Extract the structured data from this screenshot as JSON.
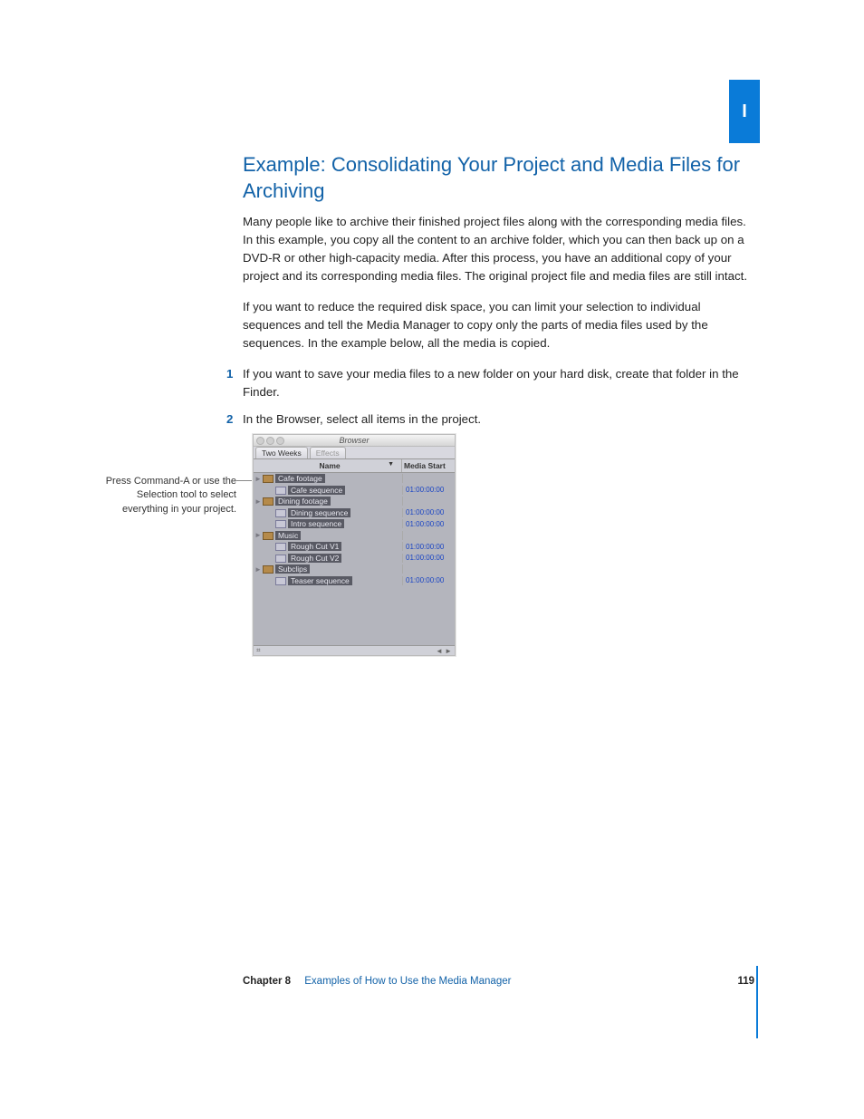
{
  "sidebar": {
    "tab_label": "I"
  },
  "heading": "Example:  Consolidating Your Project and Media Files for Archiving",
  "paragraphs": {
    "p1": "Many people like to archive their finished project files along with the corresponding media files. In this example, you copy all the content to an archive folder, which you can then back up on a DVD-R or other high-capacity media. After this process, you have an additional copy of your project and its corresponding media files. The original project file and media files are still intact.",
    "p2": "If you want to reduce the required disk space, you can limit your selection to individual sequences and tell the Media Manager to copy only the parts of media files used by the sequences. In the example below, all the media is copied."
  },
  "steps": [
    "If you want to save your media files to a new folder on your hard disk, create that folder in the Finder.",
    "In the Browser, select all items in the project."
  ],
  "caption": "Press Command-A or use the Selection tool to select everything in your project.",
  "browser": {
    "title": "Browser",
    "tabs": [
      "Two Weeks",
      "Effects"
    ],
    "columns": {
      "name": "Name",
      "media": "Media Start"
    },
    "items": [
      {
        "label": "Cafe footage",
        "type": "bin",
        "media": "",
        "arrow": true
      },
      {
        "label": "Cafe sequence",
        "type": "seq",
        "media": "01:00:00:00",
        "arrow": false
      },
      {
        "label": "Dining footage",
        "type": "bin",
        "media": "",
        "arrow": true
      },
      {
        "label": "Dining sequence",
        "type": "seq",
        "media": "01:00:00:00",
        "arrow": false
      },
      {
        "label": "Intro sequence",
        "type": "seq",
        "media": "01:00:00:00",
        "arrow": false
      },
      {
        "label": "Music",
        "type": "bin",
        "media": "",
        "arrow": true
      },
      {
        "label": "Rough Cut V1",
        "type": "seq",
        "media": "01:00:00:00",
        "arrow": false
      },
      {
        "label": "Rough Cut V2",
        "type": "seq",
        "media": "01:00:00:00",
        "arrow": false
      },
      {
        "label": "Subclips",
        "type": "bin",
        "media": "",
        "arrow": true
      },
      {
        "label": "Teaser sequence",
        "type": "seq",
        "media": "01:00:00:00",
        "arrow": false
      }
    ]
  },
  "footer": {
    "chapter_label": "Chapter 8",
    "chapter_title": "Examples of How to Use the Media Manager",
    "page_number": "119"
  }
}
